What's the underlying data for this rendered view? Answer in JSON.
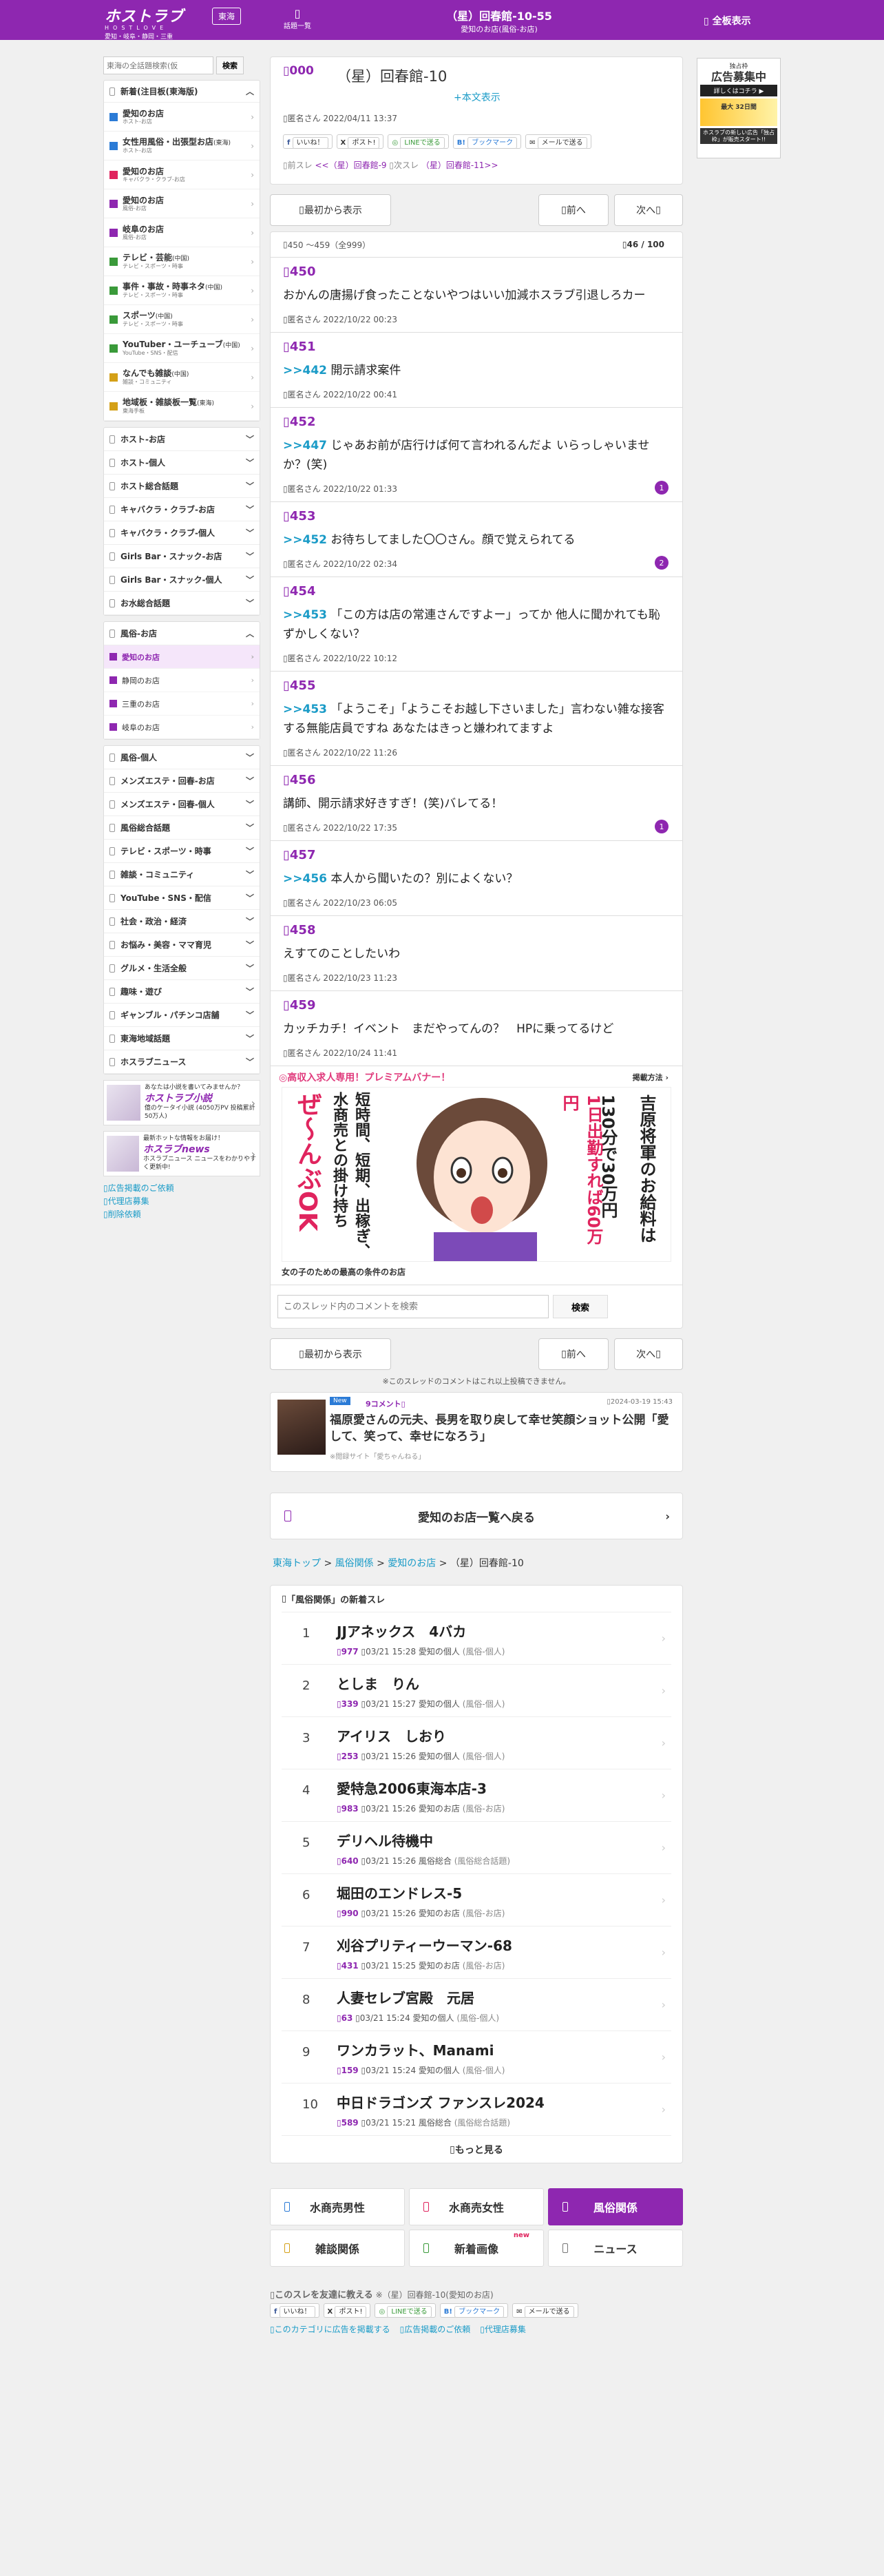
{
  "header": {
    "logo": "ホストラブ",
    "logo_en": "HOSTLOVE",
    "logo_sub": "愛知・岐阜・静岡・三重",
    "area": "東海",
    "list_label": "話題一覧",
    "title": "（星）回春館-10-55",
    "subtitle": "愛知のお店(風俗-お店)",
    "full_view": "全板表示"
  },
  "sidebar": {
    "search_placeholder": "東海の全話題検索(仮",
    "search_button": "検索",
    "new_label": "新着(注目板(東海版)",
    "new_items": [
      {
        "label": "愛知のお店",
        "sub": "ホスト-お店",
        "color": "#2b7bd6"
      },
      {
        "label": "女性用風俗・出張型お店",
        "sub": "ホスト-お店",
        "color": "#2b7bd6",
        "tag": "(東海)"
      },
      {
        "label": "愛知のお店",
        "sub": "キャバクラ・クラブ-お店",
        "color": "#e0245e"
      },
      {
        "label": "愛知のお店",
        "sub": "風俗-お店",
        "color": "#8e27b0"
      },
      {
        "label": "岐阜のお店",
        "sub": "風俗-お店",
        "color": "#8e27b0"
      },
      {
        "label": "テレビ・芸能",
        "sub": "テレビ・スポーツ・時事",
        "color": "#3a9a3a",
        "tag": "(中国)"
      },
      {
        "label": "事件・事故・時事ネタ",
        "sub": "テレビ・スポーツ・時事",
        "color": "#3a9a3a",
        "tag": "(中国)"
      },
      {
        "label": "スポーツ",
        "sub": "テレビ・スポーツ・時事",
        "color": "#3a9a3a",
        "tag": "(中国)"
      },
      {
        "label": "YouTuber・ユーチューブ",
        "sub": "YouTube・SNS・配信",
        "color": "#3a9a3a",
        "tag": "(中国)"
      },
      {
        "label": "なんでも雑談",
        "sub": "雑談・コミュニティ",
        "color": "#d4a017",
        "tag": "(中国)"
      },
      {
        "label": "地域板・雑談板一覧",
        "sub": "東海手板",
        "color": "#d4a017",
        "tag": "(東海)"
      }
    ],
    "categories_top": [
      "ホスト-お店",
      "ホスト-個人",
      "ホスト総合話題",
      "キャバクラ・クラブ-お店",
      "キャバクラ・クラブ-個人",
      "Girls Bar・スナック-お店",
      "Girls Bar・スナック-個人",
      "お水総合話題"
    ],
    "fuzoku_label": "風俗-お店",
    "fuzoku_items": [
      "愛知のお店",
      "静岡のお店",
      "三重のお店",
      "岐阜のお店"
    ],
    "categories_bottom": [
      "風俗-個人",
      "メンズエステ・回春-お店",
      "メンズエステ・回春-個人",
      "風俗総合話題",
      "テレビ・スポーツ・時事",
      "雑談・コミュニティ",
      "YouTube・SNS・配信",
      "社会・政治・経済",
      "お悩み・美容・ママ育児",
      "グルメ・生活全般",
      "趣味・遊び",
      "ギャンブル・パチンコ店舗",
      "東海地域話題",
      "ホスラブニュース"
    ],
    "promo1": {
      "top": "あなたは小説を書いてみませんか？",
      "brand": "ホストラブ小説",
      "desc": "億のケータイ小説 (4050万PV 投稿累計50万人)"
    },
    "promo2": {
      "top": "最新ホットな情報をお届け！",
      "brand": "ホスラブnews",
      "desc": "ホスラブニュース ニュースをわかりやすく更新中!"
    },
    "links": [
      "広告掲載のご依頼",
      "代理店募集",
      "削除依頼"
    ]
  },
  "ad_right": {
    "a1": "独占枠",
    "a2": "広告募集中",
    "a3": "詳しくはコチラ ▶",
    "a4": "最大 32日間",
    "a5": "ホスラブの新しい広告「独占枠」が販売スタート!!"
  },
  "op": {
    "num": "000",
    "title": "（星）回春館-10",
    "more": "+本文表示",
    "meta": "匿名さん 2022/04/11 13:37",
    "share": [
      "いいね！",
      "ポスト!",
      "LINEで送る",
      "ブックマーク",
      "メールで送る"
    ],
    "prev_label": "前スレ",
    "prev_link": "<<（星）回春館-9",
    "next_label": "次スレ",
    "next_link": "（星）回春館-11>>"
  },
  "nav": {
    "latest": "最初から表示",
    "prev": "前へ",
    "next": "次へ"
  },
  "page": {
    "range": "450 〜459（全999）",
    "count": "46 / 100"
  },
  "posts": [
    {
      "n": "450",
      "ref": "",
      "body": "おかんの唐揚げ食ったことないやつはいい加減ホスラブ引退しろカー",
      "meta": "匿名さん 2022/10/22 00:23",
      "badge": ""
    },
    {
      "n": "451",
      "ref": ">>442",
      "body": "開示請求案件",
      "meta": "匿名さん 2022/10/22 00:41",
      "badge": ""
    },
    {
      "n": "452",
      "ref": ">>447",
      "body": "じゃあお前が店行けば何て言われるんだよ いらっしゃいませか？(笑)",
      "meta": "匿名さん 2022/10/22 01:33",
      "badge": "1"
    },
    {
      "n": "453",
      "ref": ">>452",
      "body": "お待ちしてました〇〇さん。顔で覚えられてる",
      "meta": "匿名さん 2022/10/22 02:34",
      "badge": "2"
    },
    {
      "n": "454",
      "ref": ">>453",
      "body": "「この方は店の常連さんですよー」ってか 他人に聞かれても恥ずかしくない？",
      "meta": "匿名さん 2022/10/22 10:12",
      "badge": ""
    },
    {
      "n": "455",
      "ref": ">>453",
      "body": "「ようこそ」「ようこそお越し下さいました」言わない雑な接客する無能店員ですね あなたはきっと嫌われてますよ",
      "meta": "匿名さん 2022/10/22 11:26",
      "badge": ""
    },
    {
      "n": "456",
      "ref": "",
      "body": "講師、開示請求好きすぎ！(笑)バレてる！",
      "meta": "匿名さん 2022/10/22 17:35",
      "badge": "1"
    },
    {
      "n": "457",
      "ref": ">>456",
      "body": "本人から聞いたの？別によくない？",
      "meta": "匿名さん 2022/10/23 06:05",
      "badge": ""
    },
    {
      "n": "458",
      "ref": "",
      "body": "えすてのことしたいわ",
      "meta": "匿名さん 2022/10/23 11:23",
      "badge": ""
    },
    {
      "n": "459",
      "ref": "",
      "body": "カッチカチ！イベント　まだやってんの？　HPに乗ってるけど",
      "meta": "匿名さん 2022/10/24 11:41",
      "badge": ""
    }
  ],
  "banner": {
    "head": "高収入求人専用！プレミアムバナー！",
    "placement": "掲載方法 ›",
    "text1": "吉原将軍のお給料は",
    "text2": "130分で30万円",
    "text3": "1日出勤すれば60万円",
    "text4": "短時間、短期、出稼ぎ、水商売との掛け持ち",
    "text5": "ぜ〜んぶOK",
    "caption": "女の子のための最高の条件のお店"
  },
  "thread_search": {
    "placeholder": "このスレッド内のコメントを検索",
    "button": "検索"
  },
  "note": "※このスレッドのコメントはこれ以上投稿できません。",
  "news": {
    "tag": "New",
    "comments": "9コメント",
    "date": "2024-03-19 15:43",
    "title": "福原愛さんの元夫、長男を取り戻して幸せ笑顔ショット公開「愛して、笑って、幸せになろう」",
    "source": "※閲録サイト「愛ちゃんねる」"
  },
  "back": "愛知のお店一覧へ戻る",
  "breadcrumb": {
    "a": "東海トップ",
    "b": "風俗関係",
    "c": "愛知のお店",
    "d": "（星）回春館-10"
  },
  "ranking": {
    "head": "「風俗関係」の新着スレ",
    "rows": [
      {
        "no": "1",
        "t": "JJアネックス　4バカ",
        "c": "977",
        "d": "03/21 15:28",
        "b": "愛知の個人",
        "k": "(風俗-個人)"
      },
      {
        "no": "2",
        "t": "としま　りん",
        "c": "339",
        "d": "03/21 15:27",
        "b": "愛知の個人",
        "k": "(風俗-個人)"
      },
      {
        "no": "3",
        "t": "アイリス　しおり",
        "c": "253",
        "d": "03/21 15:26",
        "b": "愛知の個人",
        "k": "(風俗-個人)"
      },
      {
        "no": "4",
        "t": "愛特急2006東海本店-3",
        "c": "983",
        "d": "03/21 15:26",
        "b": "愛知のお店",
        "k": "(風俗-お店)"
      },
      {
        "no": "5",
        "t": "デリヘル待機中",
        "c": "640",
        "d": "03/21 15:26",
        "b": "風俗総合",
        "k": "(風俗総合話題)"
      },
      {
        "no": "6",
        "t": "堀田のエンドレス-5",
        "c": "990",
        "d": "03/21 15:26",
        "b": "愛知のお店",
        "k": "(風俗-お店)"
      },
      {
        "no": "7",
        "t": "刈谷プリティーウーマン-68",
        "c": "431",
        "d": "03/21 15:25",
        "b": "愛知のお店",
        "k": "(風俗-お店)"
      },
      {
        "no": "8",
        "t": "人妻セレブ宮殿　元居",
        "c": "63",
        "d": "03/21 15:24",
        "b": "愛知の個人",
        "k": "(風俗-個人)"
      },
      {
        "no": "9",
        "t": "ワンカラット、Manami",
        "c": "159",
        "d": "03/21 15:24",
        "b": "愛知の個人",
        "k": "(風俗-個人)"
      },
      {
        "no": "10",
        "t": "中日ドラゴンズ ファンスレ2024",
        "c": "589",
        "d": "03/21 15:21",
        "b": "風俗総合",
        "k": "(風俗総合話題)"
      }
    ],
    "more": "もっと見る"
  },
  "cat_buttons": [
    {
      "label": "水商売男性",
      "color": "#2b7bd6",
      "on": false,
      "new": ""
    },
    {
      "label": "水商売女性",
      "color": "#e0245e",
      "on": false,
      "new": ""
    },
    {
      "label": "風俗関係",
      "color": "#ffffff",
      "on": true,
      "new": ""
    },
    {
      "label": "雑談関係",
      "color": "#d4a017",
      "on": false,
      "new": ""
    },
    {
      "label": "新着画像",
      "color": "#3a9a3a",
      "on": false,
      "new": "new"
    },
    {
      "label": "ニュース",
      "color": "#777777",
      "on": false,
      "new": ""
    }
  ],
  "footer": {
    "share_head": "このスレを友達に教える",
    "share_thread": "※（星）回春館-10(愛知のお店)",
    "links": [
      "このカテゴリに広告を掲載する",
      "広告掲載のご依頼",
      "代理店募集"
    ]
  }
}
